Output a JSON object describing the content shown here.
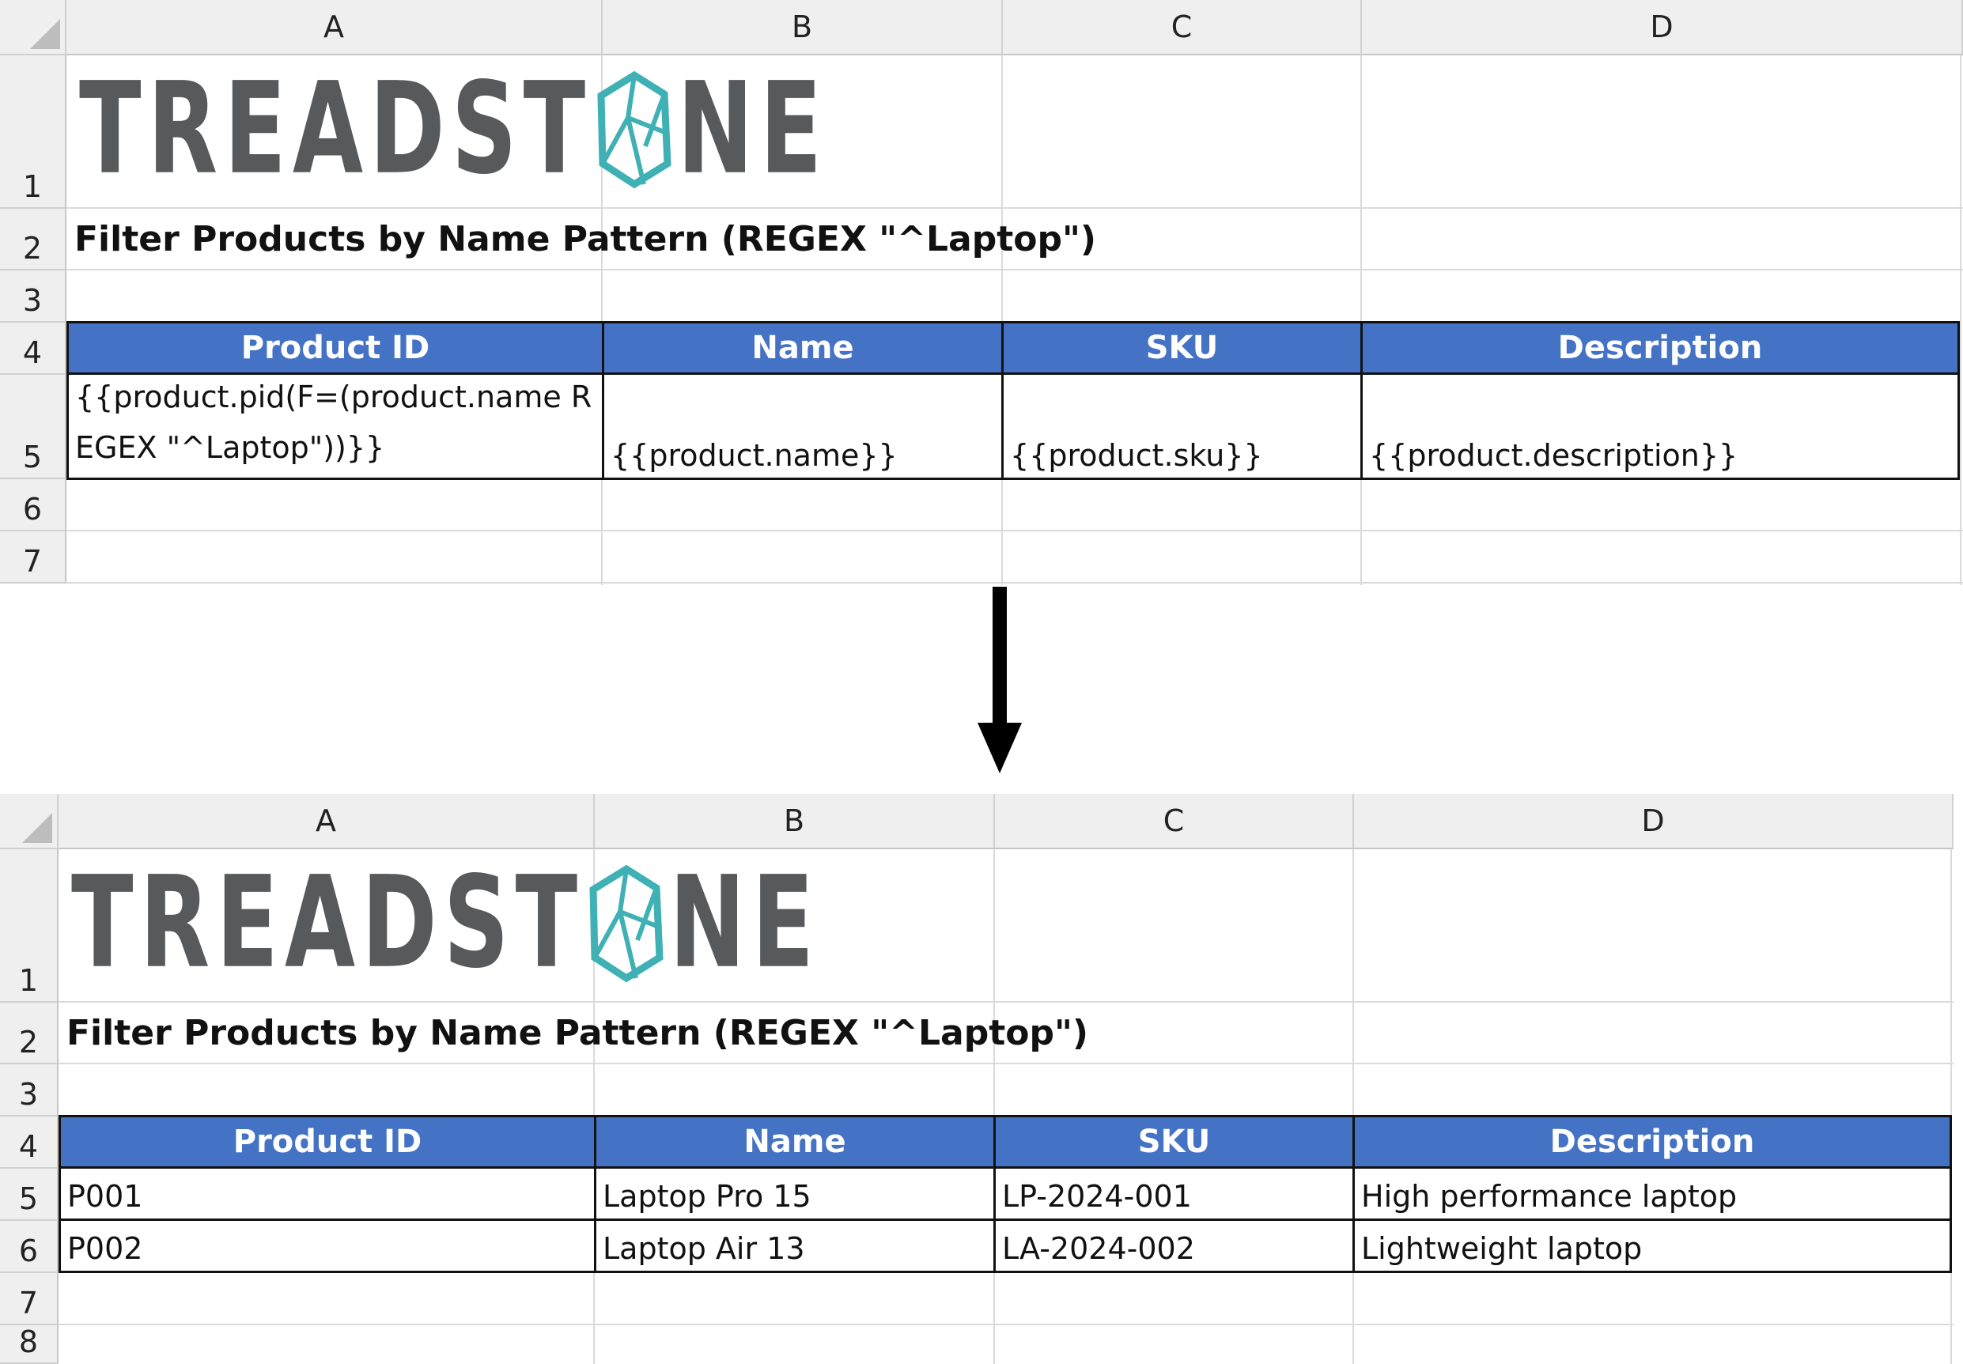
{
  "columns": [
    "A",
    "B",
    "C",
    "D"
  ],
  "brand": {
    "logo_text_left": "TREADST",
    "logo_text_right": "NE",
    "logo_full": "TREADSTONE",
    "text_color": "#58595b",
    "mark_color": "#3fb1b5"
  },
  "header_fill": "#4472c4",
  "template_sheet": {
    "row_numbers": [
      "1",
      "2",
      "3",
      "4",
      "5",
      "6",
      "7"
    ],
    "title": "Filter Products by Name Pattern (REGEX \"^Laptop\")",
    "headers": [
      "Product ID",
      "Name",
      "SKU",
      "Description"
    ],
    "row5": [
      "{{product.pid(F=(product.name REGEX \"^Laptop\"))}}",
      "{{product.name}}",
      "{{product.sku}}",
      "{{product.description}}"
    ]
  },
  "result_sheet": {
    "row_numbers": [
      "1",
      "2",
      "3",
      "4",
      "5",
      "6",
      "7",
      "8"
    ],
    "title": "Filter Products by Name Pattern (REGEX \"^Laptop\")",
    "headers": [
      "Product ID",
      "Name",
      "SKU",
      "Description"
    ],
    "rows": [
      [
        "P001",
        "Laptop Pro 15",
        "LP-2024-001",
        "High performance laptop"
      ],
      [
        "P002",
        "Laptop Air 13",
        "LA-2024-002",
        "Lightweight laptop"
      ]
    ]
  }
}
